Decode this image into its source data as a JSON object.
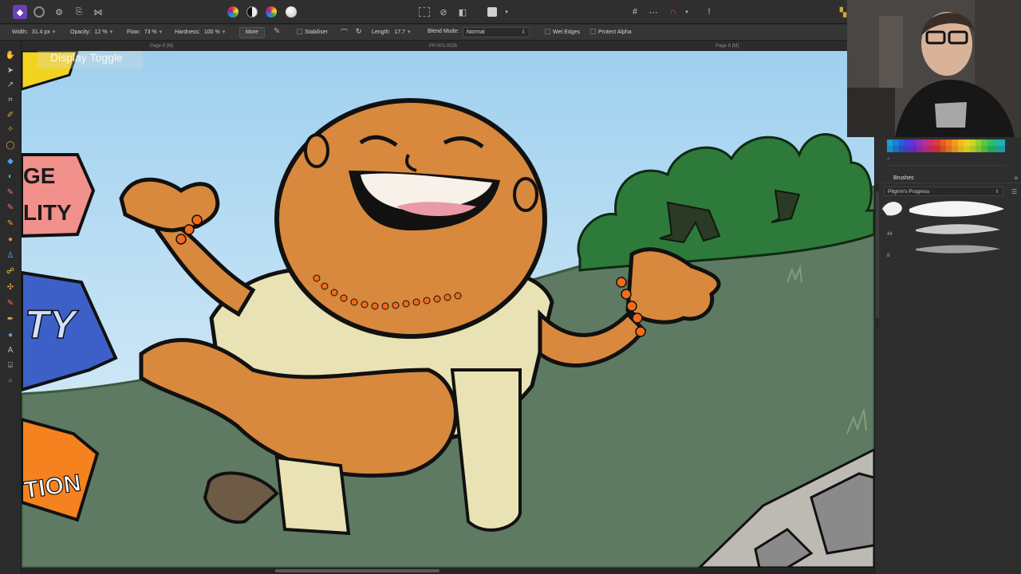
{
  "toolbar": {
    "personas": [
      "persona-photo-icon",
      "persona-draw-icon",
      "persona-export-icon",
      "persona-pixel-icon",
      "share-icon"
    ]
  },
  "context_toolbar": {
    "width_label": "Width:",
    "width_value": "31.4 px",
    "opacity_label": "Opacity:",
    "opacity_value": "12 %",
    "flow_label": "Flow:",
    "flow_value": "73 %",
    "hardness_label": "Hardness:",
    "hardness_value": "100 %",
    "more_label": "More",
    "stabiliser_label": "Stabiliser",
    "length_label": "Length:",
    "length_value": "17.7",
    "blend_mode_label": "Blend Mode:",
    "blend_mode_value": "Normal",
    "wet_edges_label": "Wet Edges",
    "protect_alpha_label": "Protect Alpha"
  },
  "page_bar": {
    "left_label": "Page 8 [M]",
    "center_label": "PP-001-002b",
    "right_label": "Page 9 [M]"
  },
  "canvas": {
    "overlay_label": "Display Toggle",
    "sign_pink_text_1": "GE",
    "sign_pink_text_2": "LITY",
    "sign_blue_text": "TY",
    "sign_orange_text": "TION"
  },
  "panels": {
    "brushes_tab": "Brushes",
    "brush_category": "Pilgrim's Progress",
    "brush_sizes": [
      "44",
      "8"
    ]
  },
  "colors": {
    "sky": "#bfe0f2",
    "grass": "#5f7a63",
    "tree": "#2e7a3a",
    "skin": "#d8893d",
    "robe": "#e9e2b4",
    "accent_purple": "#6b3fb6"
  }
}
